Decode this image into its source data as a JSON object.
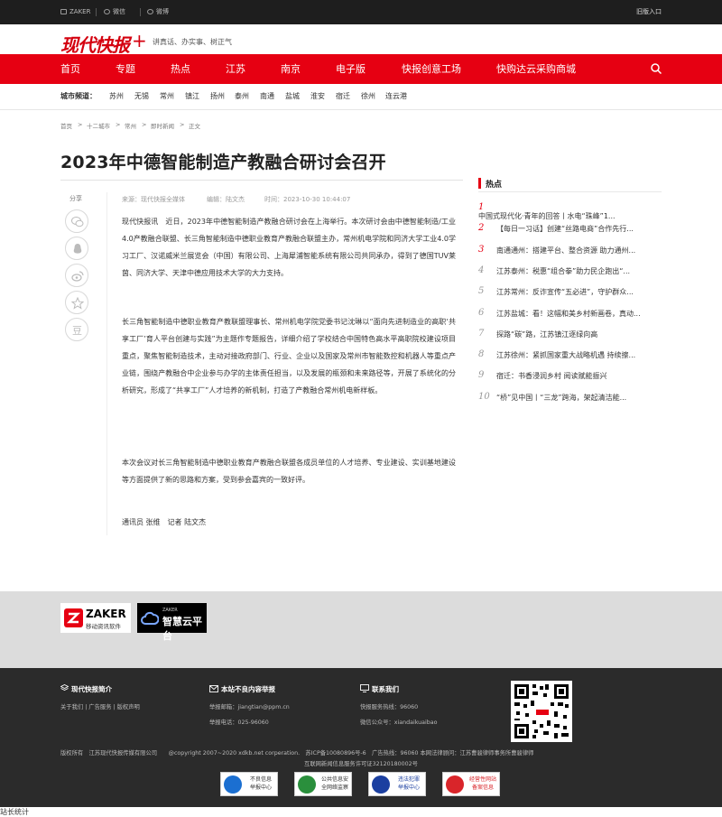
{
  "topbar": {
    "items": [
      "ZAKER",
      "微信",
      "微博"
    ],
    "login": "旧版入口"
  },
  "logo": {
    "text": "现代快报",
    "plus": "+",
    "slogan": "讲真话、办实事、树正气"
  },
  "nav": {
    "items": [
      "首页",
      "专题",
      "热点",
      "江苏",
      "南京",
      "电子版",
      "快报创意工场",
      "快购达云采购商城"
    ]
  },
  "city": {
    "label": "城市频道：",
    "items": [
      "苏州",
      "无锡",
      "常州",
      "镇江",
      "扬州",
      "泰州",
      "南通",
      "盐城",
      "淮安",
      "宿迁",
      "徐州",
      "连云港"
    ]
  },
  "breadcrumb": [
    "首页",
    ">",
    "十二城市",
    ">",
    "常州",
    ">",
    "即时新闻",
    ">",
    "正文"
  ],
  "article": {
    "title": "2023年中德智能制造产教融合研讨会召开",
    "source": "来源：现代快报全媒体",
    "editor": "编辑：陆文杰",
    "time": "时间：2023-10-30 10:44:07",
    "paragraphs": [
      "现代快报讯　近日，2023年中德智能制造产教融合研讨会在上海举行。本次研讨会由中德智能制造/工业 4.0产教融合联盟、长三角智能制造中德职业教育产教融合联盟主办，常州机电学院和同济大学工业4.0学习工厂、汉诺威米兰展览会（中国）有限公司、上海犀浦智能系统有限公司共同承办，得到了德国TUV莱茵、同济大学、天津中德应用技术大学的大力支持。",
      "长三角智能制造中德职业教育产教联盟理事长、常州机电学院党委书记沈琳以“面向先进制造业的高职‘共享工厂’育人平台创建与实践”为主题作专题报告，详细介绍了学校结合中国特色高水平高职院校建设项目重点，聚焦智能制造技术，主动对接政府部门、行业、企业以及国家及常州市智能数控和机器人等重点产业链，围绕产教融合中企业参与办学的主体责任担当，以及发展的瓶颈和未来路径等，开展了系统化的分析研究，形成了“共享工厂”人才培养的新机制，打造了产教融合常州机电新样板。",
      "本次会议对长三角智能制造中德职业教育产教融合联盟各成员单位的人才培养、专业建设、实训基地建设等方面提供了新的思路和方案，受到参会嘉宾的一致好评。",
      "通讯员 张维　记者 陆文杰"
    ]
  },
  "share": {
    "label": "分享",
    "icons": [
      "wechat-icon",
      "qq-icon",
      "weibo-icon",
      "star-icon",
      "douban-icon"
    ],
    "douban_glyph": "豆"
  },
  "hot": {
    "title": "热点",
    "items": [
      {
        "num": "1",
        "text": "中国式现代化·青年的回答丨水电“珠峰”1..."
      },
      {
        "num": "2",
        "text": "【每日一习话】创建“丝路电商”合作先行..."
      },
      {
        "num": "3",
        "text": "南通通州：搭建平台、整合资源 助力通州..."
      },
      {
        "num": "4",
        "text": "江苏泰州：税惠“组合拳”助力民企跑出“..."
      },
      {
        "num": "5",
        "text": "江苏常州：反诈宣传“五必进”，守护群众..."
      },
      {
        "num": "6",
        "text": "江苏盐城：看！这幅和美乡村新画卷，真动..."
      },
      {
        "num": "7",
        "text": "探路“碳”路，江苏镇江逐绿向高"
      },
      {
        "num": "8",
        "text": "江苏徐州：紧抓国家重大战略机遇 持续擦..."
      },
      {
        "num": "9",
        "text": "宿迁：书香浸润乡村 阅读赋能振兴"
      },
      {
        "num": "10",
        "text": "“桥”见中国丨“三龙”跨海，架起清洁能..."
      }
    ],
    "colors": {
      "red": "#e60012"
    }
  },
  "partners": {
    "zaker": {
      "name": "ZAKER",
      "sub": "移动资讯软件"
    },
    "zhihui": {
      "top": "ZAKER",
      "name": "智慧云平台"
    }
  },
  "footer": {
    "col1": {
      "head": "现代快报简介",
      "links": "关于我们 | 广告服务 | 版权声明"
    },
    "col2": {
      "head": "本站不良内容举报",
      "email": "举报邮箱：jiangtian@ppm.cn",
      "phone": "举报电话：025-96060"
    },
    "col3": {
      "head": "联系我们",
      "hotline": "快报服务热线：96060",
      "wechat": "微信公众号：xiandaikuaibao"
    },
    "copyright": "版权所有　江苏现代快报传媒有限公司　　@copyright 2007~2020 xdkb.net corperation.　苏ICP备10080896号-6　广告热线：96060 本网法律顾问：江苏曹骏律师事务所曹骏律师",
    "license": "互联网新闻信息服务许可证32120180002号",
    "badges": [
      {
        "line1": "不良信息",
        "line2": "举报中心"
      },
      {
        "line1": "公共信息安",
        "line2": "全网络监察"
      },
      {
        "line1": "违法犯罪",
        "line2": "举报中心"
      },
      {
        "line1": "经营性网站",
        "line2": "备案信息"
      }
    ]
  },
  "stat": "站长统计"
}
